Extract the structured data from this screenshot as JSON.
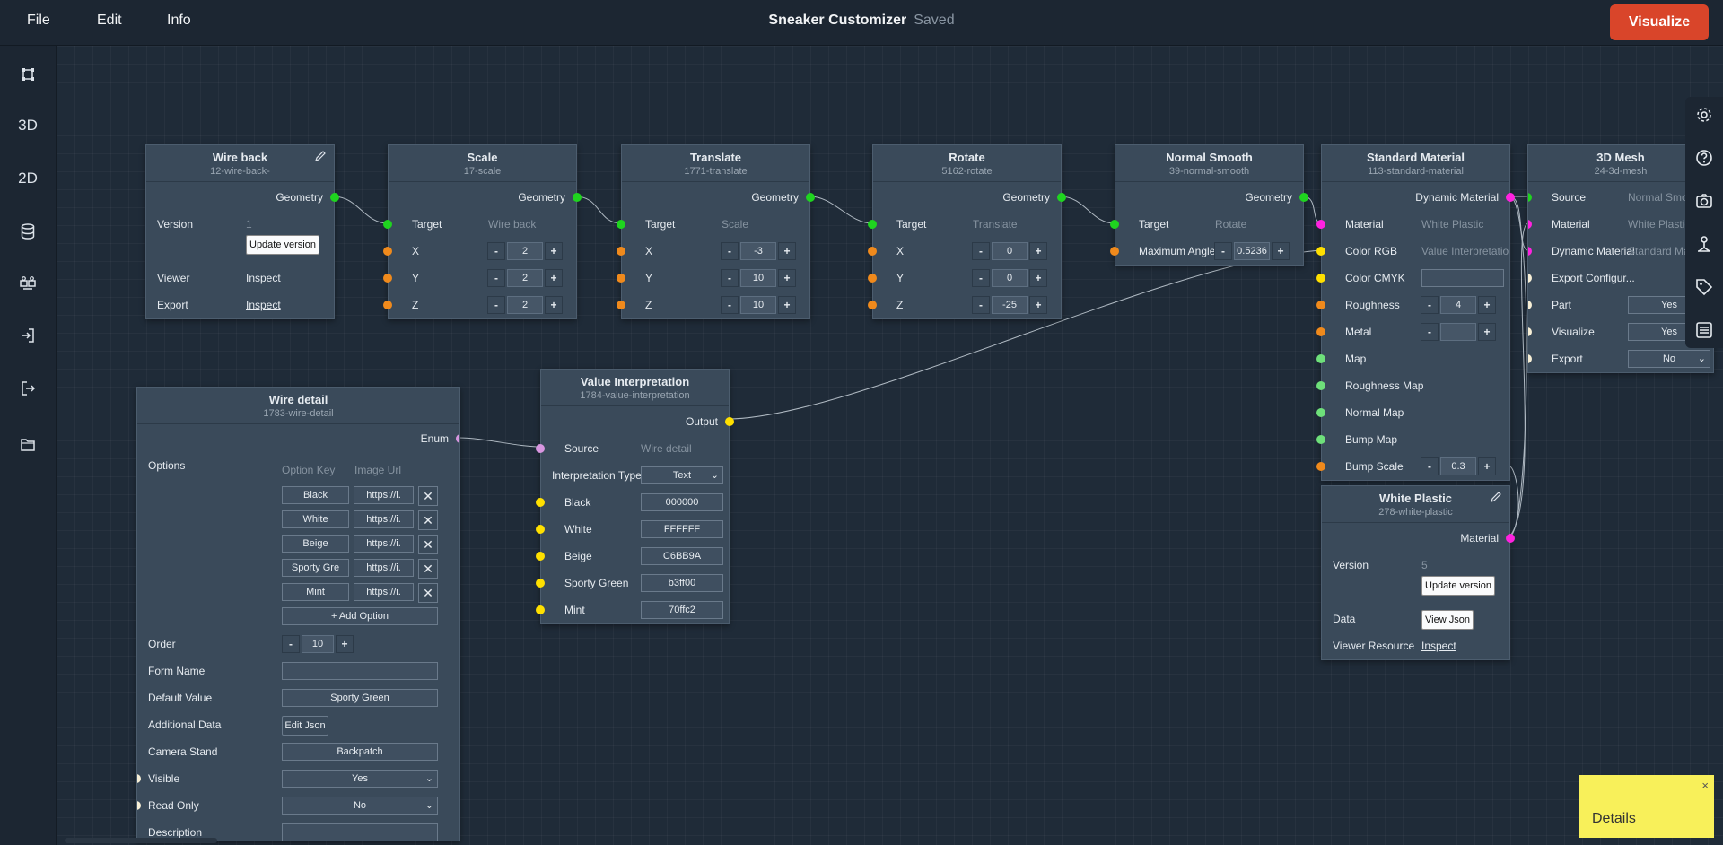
{
  "menu": {
    "file": "File",
    "edit": "Edit",
    "info": "Info"
  },
  "header": {
    "title": "Sneaker Customizer",
    "status": "Saved",
    "visualize": "Visualize"
  },
  "leftbar": {
    "label_3d": "3D",
    "label_2d": "2D"
  },
  "nodes": {
    "wire_back": {
      "title": "Wire back",
      "sub": "12-wire-back-",
      "geometry": "Geometry",
      "version_label": "Version",
      "version": "1",
      "update": "Update version",
      "viewer": "Viewer",
      "export": "Export",
      "inspect": "Inspect"
    },
    "scale": {
      "title": "Scale",
      "sub": "17-scale",
      "geometry": "Geometry",
      "target": "Target",
      "target_val": "Wire back",
      "x": "X",
      "y": "Y",
      "z": "Z",
      "xv": "2",
      "yv": "2",
      "zv": "2"
    },
    "translate": {
      "title": "Translate",
      "sub": "1771-translate",
      "geometry": "Geometry",
      "target": "Target",
      "target_val": "Scale",
      "x": "X",
      "y": "Y",
      "z": "Z",
      "xv": "-3",
      "yv": "10",
      "zv": "10"
    },
    "rotate": {
      "title": "Rotate",
      "sub": "5162-rotate",
      "geometry": "Geometry",
      "target": "Target",
      "target_val": "Translate",
      "x": "X",
      "y": "Y",
      "z": "Z",
      "xv": "0",
      "yv": "0",
      "zv": "-25"
    },
    "normal": {
      "title": "Normal Smooth",
      "sub": "39-normal-smooth",
      "geometry": "Geometry",
      "target": "Target",
      "target_val": "Rotate",
      "angle": "Maximum Angle",
      "angle_val": "0.5236"
    },
    "standard": {
      "title": "Standard Material",
      "sub": "113-standard-material",
      "dynamic": "Dynamic Material",
      "material": "Material",
      "material_val": "White Plastic",
      "rgb": "Color RGB",
      "rgb_val": "Value Interpretation",
      "cmyk": "Color CMYK",
      "rough": "Roughness",
      "rough_val": "4",
      "metal": "Metal",
      "map": "Map",
      "rmap": "Roughness Map",
      "nmap": "Normal Map",
      "bmap": "Bump Map",
      "bscale": "Bump Scale",
      "bscale_val": "0.3"
    },
    "mesh": {
      "title": "3D Mesh",
      "sub": "24-3d-mesh",
      "source": "Source",
      "source_val": "Normal Smo",
      "material": "Material",
      "material_val": "White Plastic",
      "dynamic": "Dynamic Material",
      "dynamic_val": "Standard Ma",
      "export_cfg": "Export Configur...",
      "part": "Part",
      "part_val": "Yes",
      "visualize": "Visualize",
      "visualize_val": "Yes",
      "export": "Export",
      "export_val": "No"
    },
    "white": {
      "title": "White Plastic",
      "sub": "278-white-plastic",
      "material": "Material",
      "version_label": "Version",
      "version": "5",
      "update": "Update version",
      "data": "Data",
      "view_json": "View Json",
      "viewer": "Viewer Resource",
      "inspect": "Inspect"
    },
    "value": {
      "title": "Value Interpretation",
      "sub": "1784-value-interpretation",
      "output": "Output",
      "source": "Source",
      "source_val": "Wire detail",
      "type_label": "Interpretation Type",
      "type_val": "Text",
      "entries": [
        {
          "k": "Black",
          "v": "000000"
        },
        {
          "k": "White",
          "v": "FFFFFF"
        },
        {
          "k": "Beige",
          "v": "C6BB9A"
        },
        {
          "k": "Sporty Green",
          "v": "b3ff00"
        },
        {
          "k": "Mint",
          "v": "70ffc2"
        }
      ]
    },
    "wire_detail": {
      "title": "Wire detail",
      "sub": "1783-wire-detail",
      "enum": "Enum",
      "options": "Options",
      "col_key": "Option Key",
      "col_url": "Image Url",
      "opts": [
        {
          "k": "Black",
          "u": "https://i."
        },
        {
          "k": "White",
          "u": "https://i."
        },
        {
          "k": "Beige",
          "u": "https://i."
        },
        {
          "k": "Sporty Gre",
          "u": "https://i."
        },
        {
          "k": "Mint",
          "u": "https://i."
        }
      ],
      "add": "+ Add Option",
      "order": "Order",
      "order_val": "10",
      "form_name": "Form Name",
      "default": "Default Value",
      "default_val": "Sporty Green",
      "additional": "Additional Data",
      "edit_json": "Edit Json",
      "camera": "Camera Stand",
      "camera_val": "Backpatch",
      "visible": "Visible",
      "visible_val": "Yes",
      "readonly": "Read Only",
      "readonly_val": "No",
      "description": "Description"
    }
  },
  "sticky": {
    "text": "Details",
    "close": "×"
  },
  "glyphs": {
    "minus": "-",
    "plus": "+",
    "x": "✕",
    "chev": "⌄"
  },
  "colors": {
    "accent": "#d9452a",
    "node": "#3a4a5a",
    "geometry_port": "#1fd41f",
    "number_port": "#f08a1c",
    "color_port": "#ffe000",
    "material_port": "#ff22e0"
  }
}
